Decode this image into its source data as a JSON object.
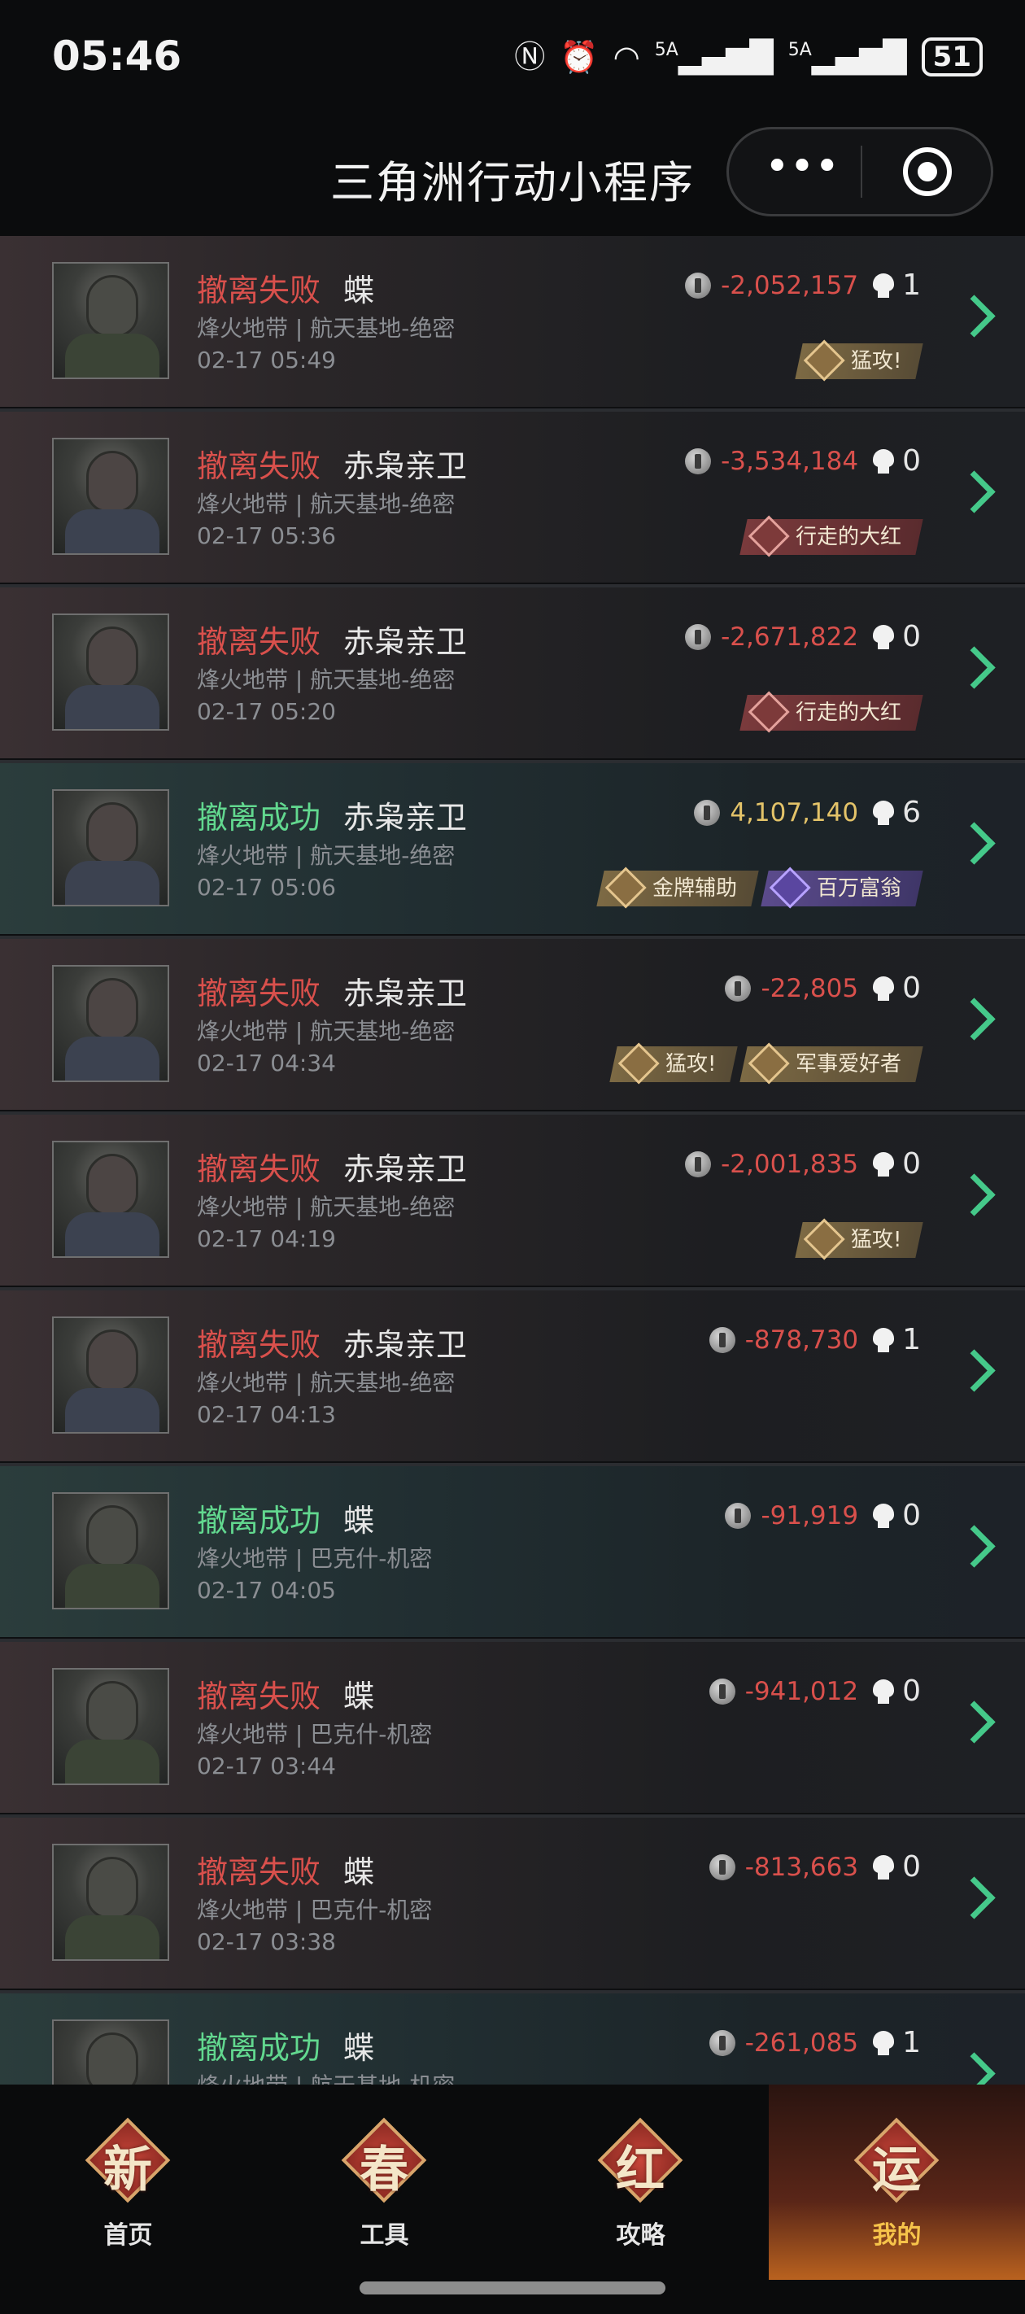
{
  "status_bar": {
    "time": "05:46",
    "icons": [
      "nfc-icon",
      "alarm-icon",
      "wifi-6-icon",
      "5g-signal-icon",
      "5g-signal-icon"
    ],
    "network_1": "5A",
    "network_2": "5A",
    "battery": "51"
  },
  "header": {
    "title": "三角洲行动小程序",
    "more_glyph": "•••"
  },
  "records": [
    {
      "result": "撤离失败",
      "outcome": "fail",
      "player": "蝶",
      "map": "烽火地带 | 航天基地-绝密",
      "time": "02-17 05:49",
      "value": "-2,052,157",
      "kills": "1",
      "badges": [
        {
          "label": "猛攻!",
          "style": "gold"
        }
      ]
    },
    {
      "result": "撤离失败",
      "outcome": "fail",
      "player": "赤枭亲卫",
      "map": "烽火地带 | 航天基地-绝密",
      "time": "02-17 05:36",
      "value": "-3,534,184",
      "kills": "0",
      "badges": [
        {
          "label": "行走的大红",
          "style": "red"
        }
      ]
    },
    {
      "result": "撤离失败",
      "outcome": "fail",
      "player": "赤枭亲卫",
      "map": "烽火地带 | 航天基地-绝密",
      "time": "02-17 05:20",
      "value": "-2,671,822",
      "kills": "0",
      "badges": [
        {
          "label": "行走的大红",
          "style": "red"
        }
      ]
    },
    {
      "result": "撤离成功",
      "outcome": "success",
      "player": "赤枭亲卫",
      "map": "烽火地带 | 航天基地-绝密",
      "time": "02-17 05:06",
      "value": "4,107,140",
      "kills": "6",
      "badges": [
        {
          "label": "金牌辅助",
          "style": "gold"
        },
        {
          "label": "百万富翁",
          "style": "purple"
        }
      ]
    },
    {
      "result": "撤离失败",
      "outcome": "fail",
      "player": "赤枭亲卫",
      "map": "烽火地带 | 航天基地-绝密",
      "time": "02-17 04:34",
      "value": "-22,805",
      "kills": "0",
      "badges": [
        {
          "label": "猛攻!",
          "style": "gold"
        },
        {
          "label": "军事爱好者",
          "style": "gold"
        }
      ]
    },
    {
      "result": "撤离失败",
      "outcome": "fail",
      "player": "赤枭亲卫",
      "map": "烽火地带 | 航天基地-绝密",
      "time": "02-17 04:19",
      "value": "-2,001,835",
      "kills": "0",
      "badges": [
        {
          "label": "猛攻!",
          "style": "gold"
        }
      ]
    },
    {
      "result": "撤离失败",
      "outcome": "fail",
      "player": "赤枭亲卫",
      "map": "烽火地带 | 航天基地-绝密",
      "time": "02-17 04:13",
      "value": "-878,730",
      "kills": "1",
      "badges": []
    },
    {
      "result": "撤离成功",
      "outcome": "success",
      "player": "蝶",
      "map": "烽火地带 | 巴克什-机密",
      "time": "02-17 04:05",
      "value": "-91,919",
      "kills": "0",
      "badges": []
    },
    {
      "result": "撤离失败",
      "outcome": "fail",
      "player": "蝶",
      "map": "烽火地带 | 巴克什-机密",
      "time": "02-17 03:44",
      "value": "-941,012",
      "kills": "0",
      "badges": []
    },
    {
      "result": "撤离失败",
      "outcome": "fail",
      "player": "蝶",
      "map": "烽火地带 | 巴克什-机密",
      "time": "02-17 03:38",
      "value": "-813,663",
      "kills": "0",
      "badges": []
    },
    {
      "result": "撤离成功",
      "outcome": "success",
      "player": "蝶",
      "map": "烽火地带 | 航天基地-机密",
      "time": "",
      "value": "-261,085",
      "kills": "1",
      "badges": []
    }
  ],
  "tabbar": {
    "items": [
      {
        "glyph": "新",
        "label": "首页",
        "active": false
      },
      {
        "glyph": "春",
        "label": "工具",
        "active": false
      },
      {
        "glyph": "红",
        "label": "攻略",
        "active": false
      },
      {
        "glyph": "运",
        "label": "我的",
        "active": true
      }
    ]
  },
  "colors": {
    "fail": "#d9504c",
    "success": "#62d88f",
    "positive_value": "#e3c369",
    "chevron": "#45c98a",
    "active_tab_label": "#f6c34a"
  }
}
